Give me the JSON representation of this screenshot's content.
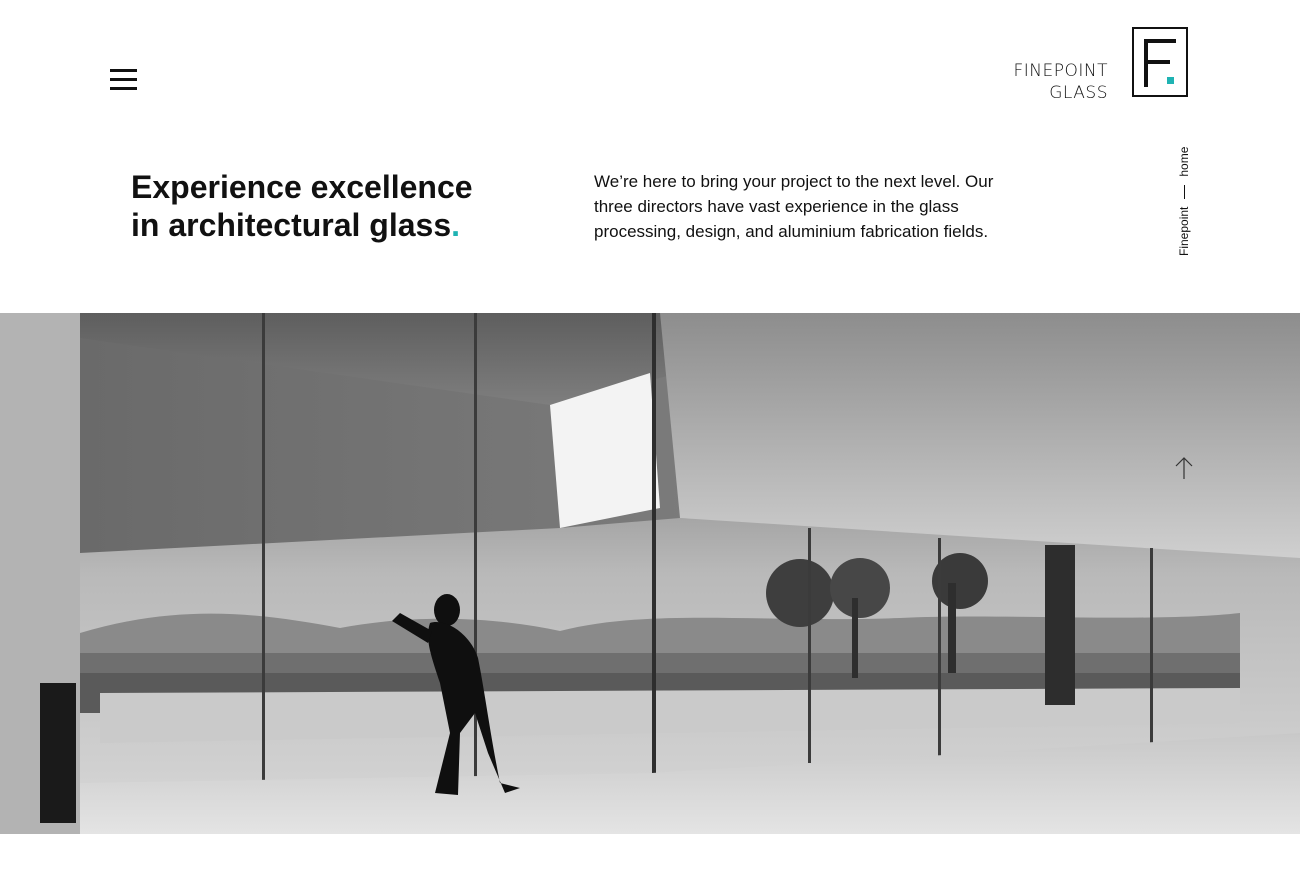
{
  "header": {
    "menu_icon": "hamburger-menu-icon",
    "logo": {
      "line1": "FINEPOINT",
      "line2": "GLASS",
      "mark_letter": "F",
      "mark_dot_color": "#1fb3b3"
    }
  },
  "hero_intro": {
    "headline_line1": "Experience excellence",
    "headline_line2": "in architectural glass",
    "headline_dot": ".",
    "accent_color": "#1fb3b3",
    "description": "We’re here to bring your project to the next level. Our three directors have vast experience in the glass processing, design, and aluminium fabrication fields."
  },
  "breadcrumb": {
    "root": "Finepoint",
    "current": "home"
  },
  "hero_image": {
    "subject": "black-and-white photo of a person leaning on a large glass wall overlooking hills",
    "scroll_icon": "arrow-up-icon"
  }
}
